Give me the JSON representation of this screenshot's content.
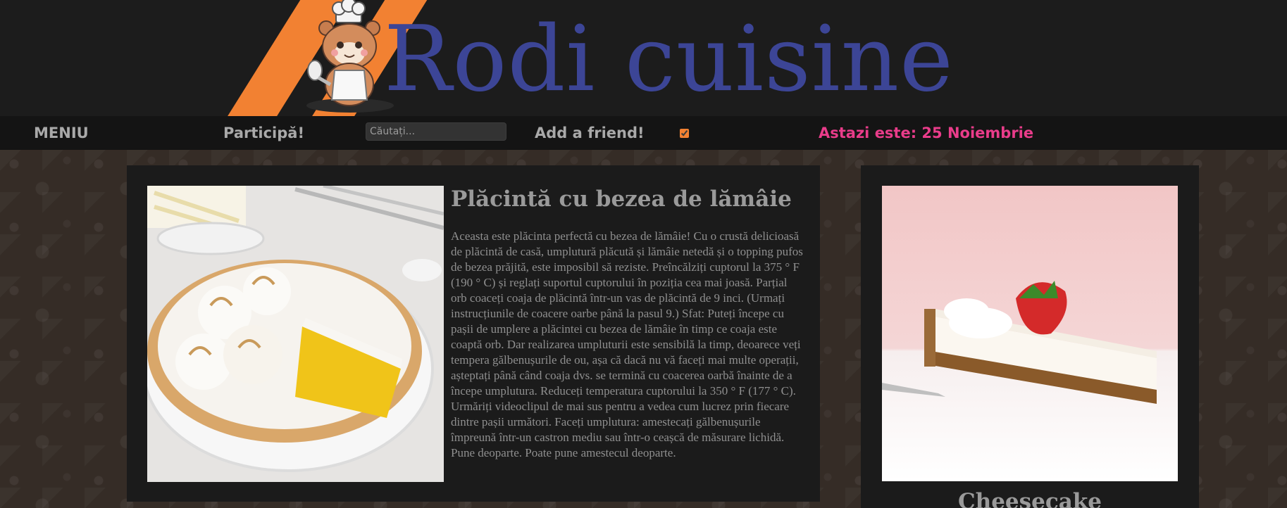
{
  "header": {
    "site_title": "Rodi cuisine",
    "logo_icon": "chef-hamster-mascot-icon",
    "accent_color": "#f28132",
    "title_color": "#3c4596"
  },
  "nav": {
    "menu_label": "MENIU",
    "participate_label": "Participă!",
    "search_placeholder": "Căutați...",
    "add_friend_label": "Add a friend!",
    "checkbox_checked": true,
    "date_text": "Astazi este: 25 Noiembrie",
    "date_color": "#e93c8a"
  },
  "main_recipe": {
    "title": "Plăcintă cu bezea de lămâie",
    "image": "lemon-meringue-pie-photo",
    "paragraphs": [
      "Aceasta este plăcinta perfectă cu bezea de lămâie! Cu o crustă delicioasă de plăcintă de casă, umplutură plăcută și lămâie netedă și o topping pufos de bezea prăjită, este imposibil să reziste. Preîncălziți cuptorul la 375 ° F (190 ° C) și reglați suportul cuptorului în poziția cea mai joasă. Parțial orb coaceți coaja de plăcintă într-un vas de plăcintă de 9 inci. (Urmați instrucțiunile de coacere oarbe până la pasul 9.) Sfat: Puteți începe cu pașii de umplere a plăcintei cu bezea de lămâie în timp ce coaja este coaptă orb. Dar realizarea umpluturii este sensibilă la timp, deoarece veți tempera gălbenușurile de ou, așa că dacă nu vă faceți mai multe operații, așteptați până când coaja dvs. se termină cu coacerea oarbă înainte de a începe umplutura. Reduceți temperatura cuptorului la 350 ° F (177 ° C).",
      "Urmăriți videoclipul de mai sus pentru a vedea cum lucrez prin fiecare dintre pașii următori. Faceți umplutura: amestecați gălbenușurile împreună într-un castron mediu sau într-o ceașcă de măsurare lichidă. Pune deoparte. Poate pune amestecul deoparte."
    ]
  },
  "side_recipe": {
    "title": "Cheesecake",
    "image": "cheesecake-slice-photo"
  }
}
